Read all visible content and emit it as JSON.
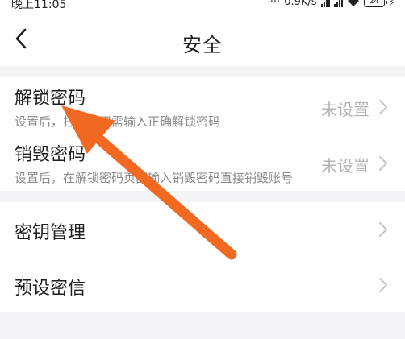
{
  "status": {
    "time": "晚上11:05",
    "dots": "···",
    "speed": "0.9K/s",
    "battery": "24"
  },
  "header": {
    "title": "安全"
  },
  "settings": {
    "unlock_password": {
      "title": "解锁密码",
      "description": "设置后，打开应用需输入正确解锁密码",
      "value": "未设置"
    },
    "destroy_password": {
      "title": "销毁密码",
      "description": "设置后，在解锁密码页面输入销毁密码直接销毁账号",
      "value": "未设置"
    },
    "key_management": {
      "title": "密钥管理"
    },
    "preset_message": {
      "title": "预设密信"
    }
  },
  "colors": {
    "annotation_arrow": "#f26a21",
    "background": "#f4f4f6",
    "secondary_text": "#8a8a8a",
    "value_text": "#b3b3b3"
  }
}
